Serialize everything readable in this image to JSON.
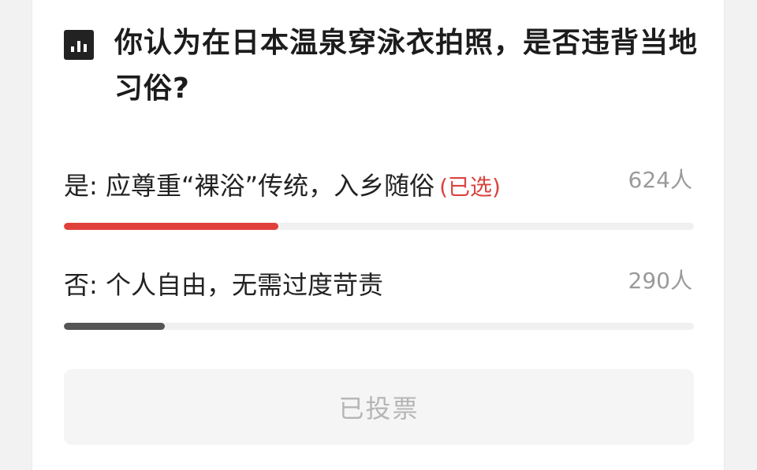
{
  "poll": {
    "question": "你认为在日本温泉穿泳衣拍照，是否违背当地习俗?",
    "icon": "poll-chart-icon",
    "options": [
      {
        "label": "是: 应尊重“裸浴”传统，入乡随俗",
        "selected_tag": "(已选)",
        "count": "624人",
        "fill_fraction": 0.34,
        "bar_color": "#e0403c"
      },
      {
        "label": "否: 个人自由，无需过度苛责",
        "selected_tag": "",
        "count": "290人",
        "fill_fraction": 0.16,
        "bar_color": "#555555"
      }
    ],
    "vote_button_label": "已投票"
  }
}
